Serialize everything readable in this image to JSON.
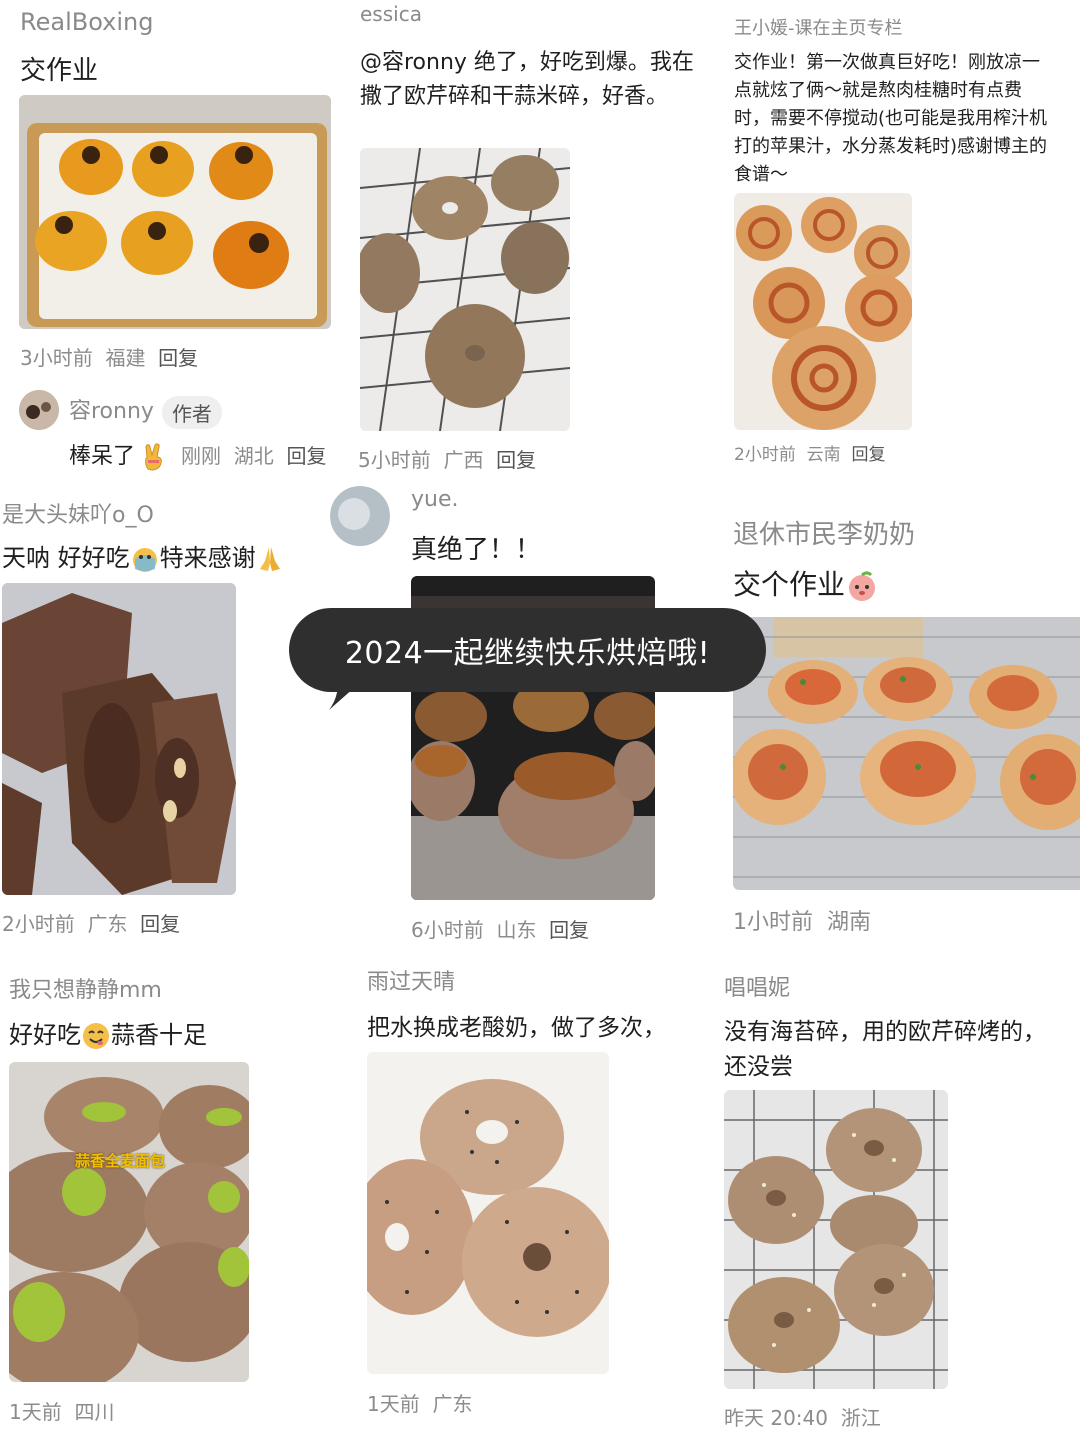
{
  "bubble": {
    "text": "2024一起继续快乐烘焙哦!"
  },
  "col1": {
    "card1": {
      "user": "RealBoxing",
      "text": "交作业",
      "time": "3小时前",
      "place": "福建",
      "reply": "回复",
      "sub": {
        "user": "容ronny",
        "badge": "作者",
        "text": "棒呆了",
        "time": "刚刚",
        "place": "湖北",
        "reply": "回复"
      }
    },
    "card2": {
      "user": "是大头妹吖o_O",
      "text_a": "天呐 好好吃",
      "text_b": "特来感谢",
      "time": "2小时前",
      "place": "广东",
      "reply": "回复"
    },
    "card3": {
      "user": "我只想静静mm",
      "text_a": "好好吃",
      "text_b": "蒜香十足",
      "photo_label": "蒜香全麦面包",
      "time": "1天前",
      "place": "四川"
    }
  },
  "col2": {
    "card1": {
      "user": "essica",
      "line1": "@容ronny 绝了，好吃到爆。我在",
      "line2": "撒了欧芹碎和干蒜米碎，好香。",
      "time": "5小时前",
      "place": "广西",
      "reply": "回复"
    },
    "card2": {
      "user": "yue.",
      "text": "真绝了！！",
      "time": "6小时前",
      "place": "山东",
      "reply": "回复"
    },
    "card3": {
      "user": "雨过天晴",
      "text": "把水换成老酸奶，做了多次，",
      "time": "1天前",
      "place": "广东"
    }
  },
  "col3": {
    "card1": {
      "user": "王小媛-课在主页专栏",
      "lines": [
        "交作业！第一次做真巨好吃！刚放凉一",
        "点就炫了俩～就是熬肉桂糖时有点费",
        "时，需要不停搅动(也可能是我用榨汁机",
        "打的苹果汁，水分蒸发耗时)感谢博主的",
        "食谱～"
      ],
      "time": "2小时前",
      "place": "云南",
      "reply": "回复"
    },
    "card2": {
      "user": "退休市民李奶奶",
      "text": "交个作业",
      "time": "1小时前",
      "place": "湖南"
    },
    "card3": {
      "user": "唱唱妮",
      "line1": "没有海苔碎，用的欧芹碎烤的，",
      "line2": "还没尝",
      "time": "昨天 20:40",
      "place": "浙江"
    }
  }
}
